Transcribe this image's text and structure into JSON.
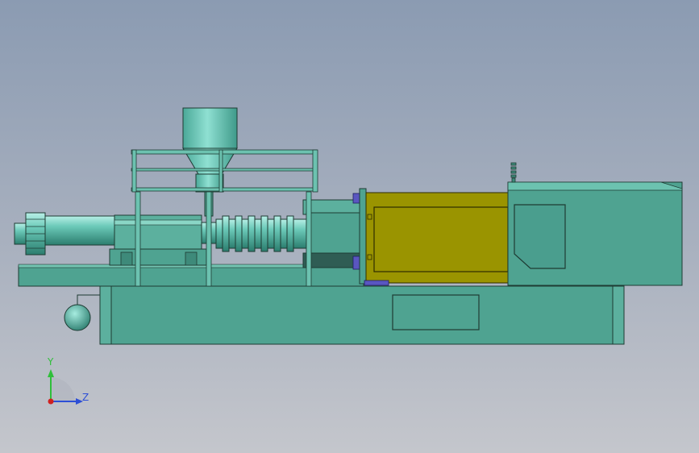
{
  "viewport": {
    "background_top": "#8b9bb2",
    "background_bottom": "#c4c6cc"
  },
  "colors": {
    "machine_body": "#4fa391",
    "machine_edge": "#1e3b33",
    "clamp_unit": "#9a9400",
    "hopper": "#58b8a8",
    "accent_blue": "#5a56c0"
  },
  "triad": {
    "y_label": "Y",
    "z_label": "Z",
    "y_color": "#2fbf3a",
    "z_color": "#2d4fd6",
    "origin_color": "#d02020"
  },
  "parts": [
    "machine-base",
    "hopper",
    "guard-rail",
    "injection-barrel",
    "screw-section",
    "clamp-unit",
    "hydraulic-housing",
    "oil-tank"
  ]
}
